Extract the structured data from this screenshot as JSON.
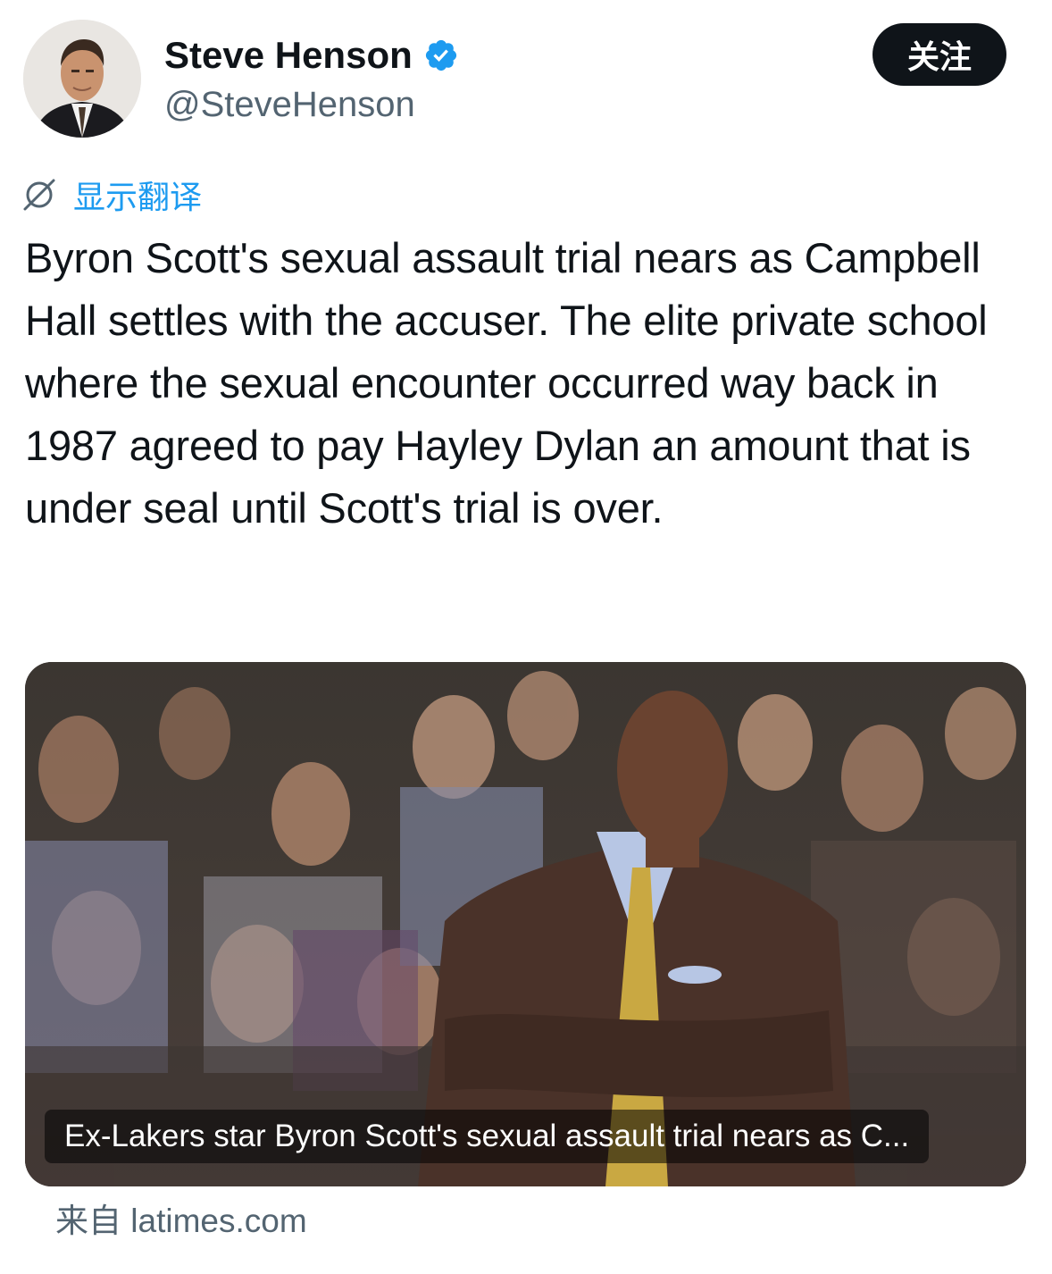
{
  "author": {
    "display_name": "Steve Henson",
    "handle": "@SteveHenson",
    "verified": true
  },
  "follow_button": {
    "label": "关注"
  },
  "translate": {
    "label": "显示翻译",
    "icon": "translate-icon"
  },
  "tweet": {
    "text": "Byron Scott's sexual assault trial nears as Campbell Hall settles with the accuser. The elite private school where the sexual encounter occurred way back in 1987 agreed to pay Hayley Dylan an amount that is under seal until Scott's trial is over."
  },
  "link_card": {
    "caption": "Ex-Lakers star Byron Scott's sexual assault trial nears as C...",
    "source_prefix": "来自",
    "source_domain": "latimes.com"
  },
  "colors": {
    "text_primary": "#0f1419",
    "text_secondary": "#536471",
    "accent_blue": "#1d9bf0",
    "button_bg": "#0f1419"
  }
}
